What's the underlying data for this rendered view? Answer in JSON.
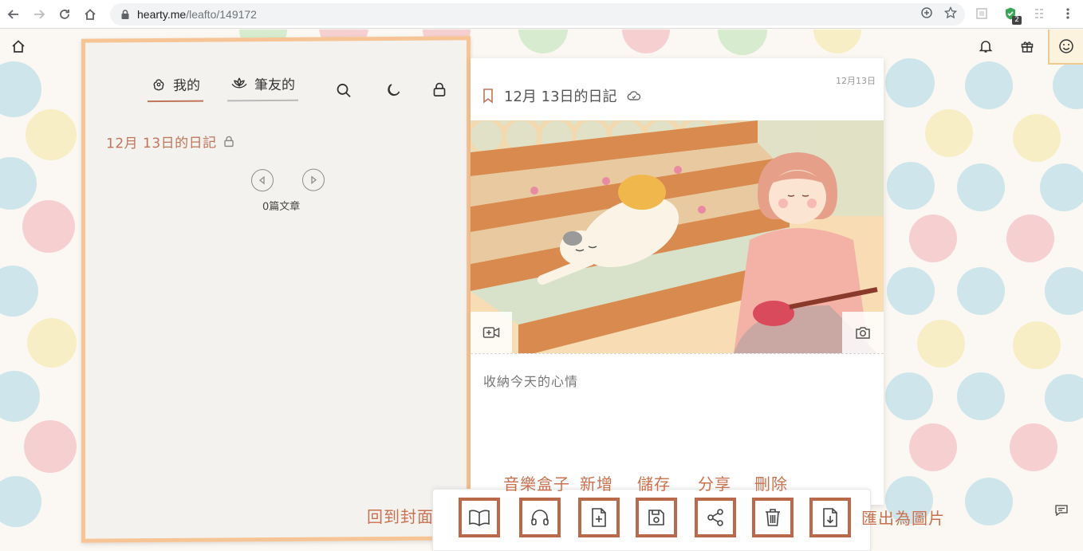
{
  "browser": {
    "url_host": "hearty.me",
    "url_path": "/leafto/149172",
    "extension_badge": "2"
  },
  "left_page": {
    "tabs": [
      {
        "label": "我的",
        "icon": "flower-icon",
        "active": true
      },
      {
        "label": "筆友的",
        "icon": "lotus-icon",
        "active": false
      }
    ],
    "diary_title": "12月 13日的日記",
    "article_count": "0篇文章"
  },
  "right_page": {
    "date": "12月13日",
    "entry_title": "12月 13日的日記",
    "mood_placeholder": "收納今天的心情"
  },
  "toolbar": {
    "labels": {
      "cover": "回到封面",
      "music": "音樂盒子",
      "add": "新增",
      "save": "儲存",
      "share": "分享",
      "delete": "刪除",
      "export": "匯出為圖片"
    }
  },
  "colors": {
    "accent": "#c0755a",
    "book_border": "#f7c595",
    "toolbar_box": "#b96a4b"
  }
}
